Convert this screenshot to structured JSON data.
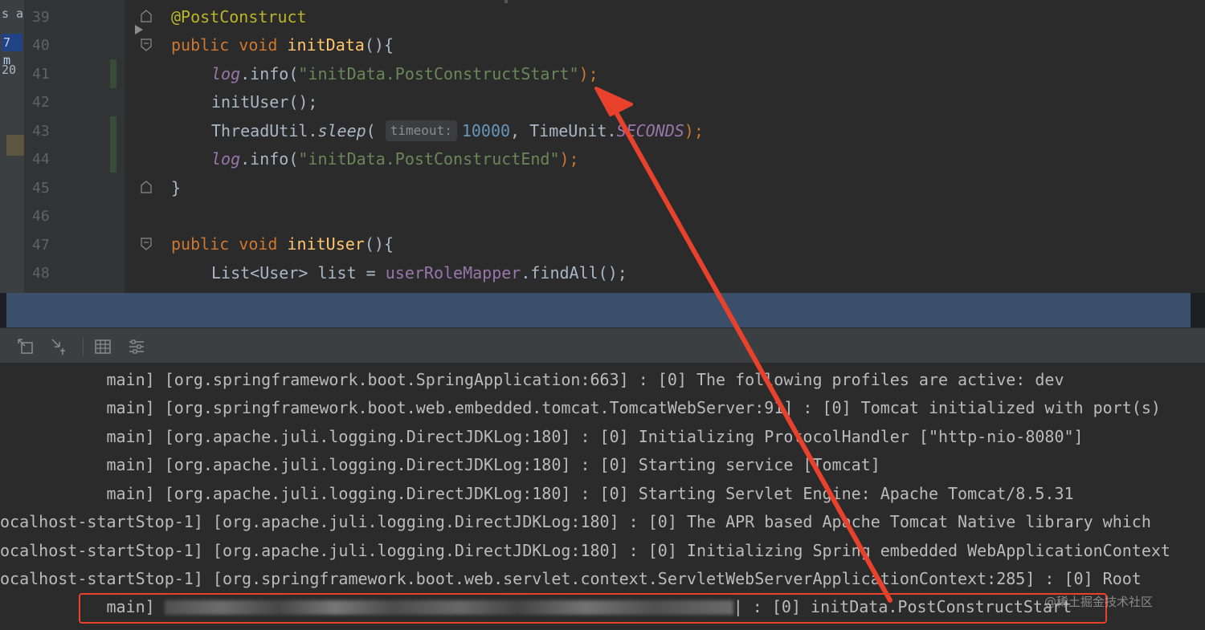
{
  "editor": {
    "left_strip": [
      "s a",
      "7 m",
      "20"
    ],
    "line_numbers": [
      "39",
      "40",
      "41",
      "42",
      "43",
      "44",
      "45",
      "46",
      "47",
      "48"
    ],
    "code": {
      "l39": {
        "annotation": "@PostConstruct"
      },
      "l40": {
        "kw1": "public",
        "kw2": "void",
        "method": "initData",
        "rest": "(){"
      },
      "l41": {
        "field": "log",
        "call": ".info(",
        "string": "\"initData.PostConstructStart\"",
        "end": ");"
      },
      "l42": {
        "text": "initUser();"
      },
      "l43": {
        "cls": "ThreadUtil.",
        "static_call": "sleep",
        "paren": "(",
        "hint": "timeout:",
        "number": "10000",
        "mid": ", TimeUnit.",
        "enum_value": "SECONDS",
        "end": ");"
      },
      "l44": {
        "field": "log",
        "call": ".info(",
        "string": "\"initData.PostConstructEnd\"",
        "end": ");"
      },
      "l45": {
        "text": "}"
      },
      "l47": {
        "kw1": "public",
        "kw2": "void",
        "method": "initUser",
        "rest": "(){"
      },
      "l48": {
        "pre": "List<User> list = ",
        "field": "userRoleMapper",
        "post": ".findAll();"
      }
    }
  },
  "console": {
    "toolbar_icons": [
      "restore-layout-icon",
      "pin-tab-icon",
      "table-view-icon",
      "settings-list-icon"
    ],
    "lines": [
      "           main] [org.springframework.boot.SpringApplication:663] : [0] The following profiles are active: dev",
      "           main] [org.springframework.boot.web.embedded.tomcat.TomcatWebServer:91] : [0] Tomcat initialized with port(s)",
      "           main] [org.apache.juli.logging.DirectJDKLog:180] : [0] Initializing ProtocolHandler [\"http-nio-8080\"]",
      "           main] [org.apache.juli.logging.DirectJDKLog:180] : [0] Starting service [Tomcat]",
      "           main] [org.apache.juli.logging.DirectJDKLog:180] : [0] Starting Servlet Engine: Apache Tomcat/8.5.31",
      "ocalhost-startStop-1] [org.apache.juli.logging.DirectJDKLog:180] : [0] The APR based Apache Tomcat Native library which",
      "ocalhost-startStop-1] [org.apache.juli.logging.DirectJDKLog:180] : [0] Initializing Spring embedded WebApplicationContext",
      "ocalhost-startStop-1] [org.springframework.boot.web.servlet.context.ServletWebServerApplicationContext:285] : [0] Root"
    ],
    "highlighted_line": {
      "thread": "           main] ",
      "tail": "| : [0] initData.PostConstructStart"
    }
  },
  "annotation": {
    "box_color": "#e8412c",
    "arrow_color": "#e8412c"
  },
  "watermark": "@稀土掘金技术社区"
}
